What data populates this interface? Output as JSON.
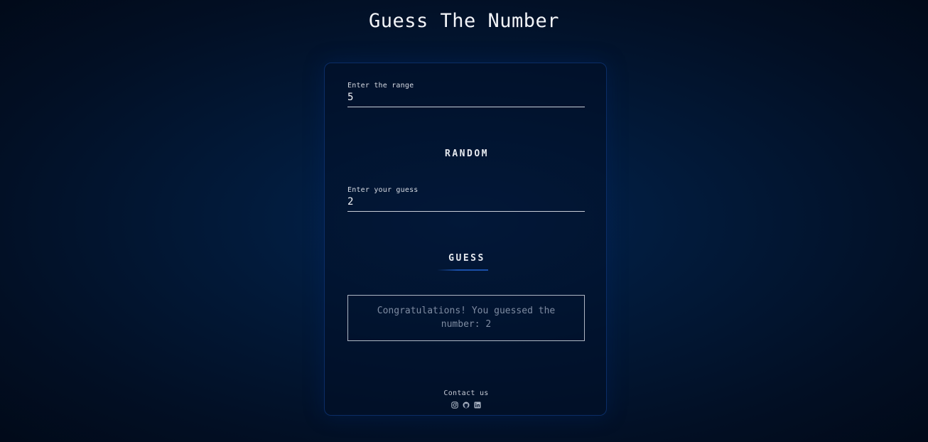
{
  "app": {
    "title": "Guess The Number"
  },
  "range_field": {
    "label": "Enter the range",
    "value": "5"
  },
  "random_button": {
    "label": "RANDOM"
  },
  "guess_field": {
    "label": "Enter your guess",
    "value": "2"
  },
  "guess_button": {
    "label": "GUESS"
  },
  "result": {
    "message": "Congratulations! You guessed the number: 2"
  },
  "footer": {
    "contact_label": "Contact us",
    "socials": [
      "instagram-icon",
      "github-icon",
      "linkedin-icon"
    ]
  },
  "colors": {
    "background": "#021a3a",
    "card_border": "#0b2d66",
    "accent": "#1a4fa8",
    "result_text": "#7f8ca2"
  }
}
